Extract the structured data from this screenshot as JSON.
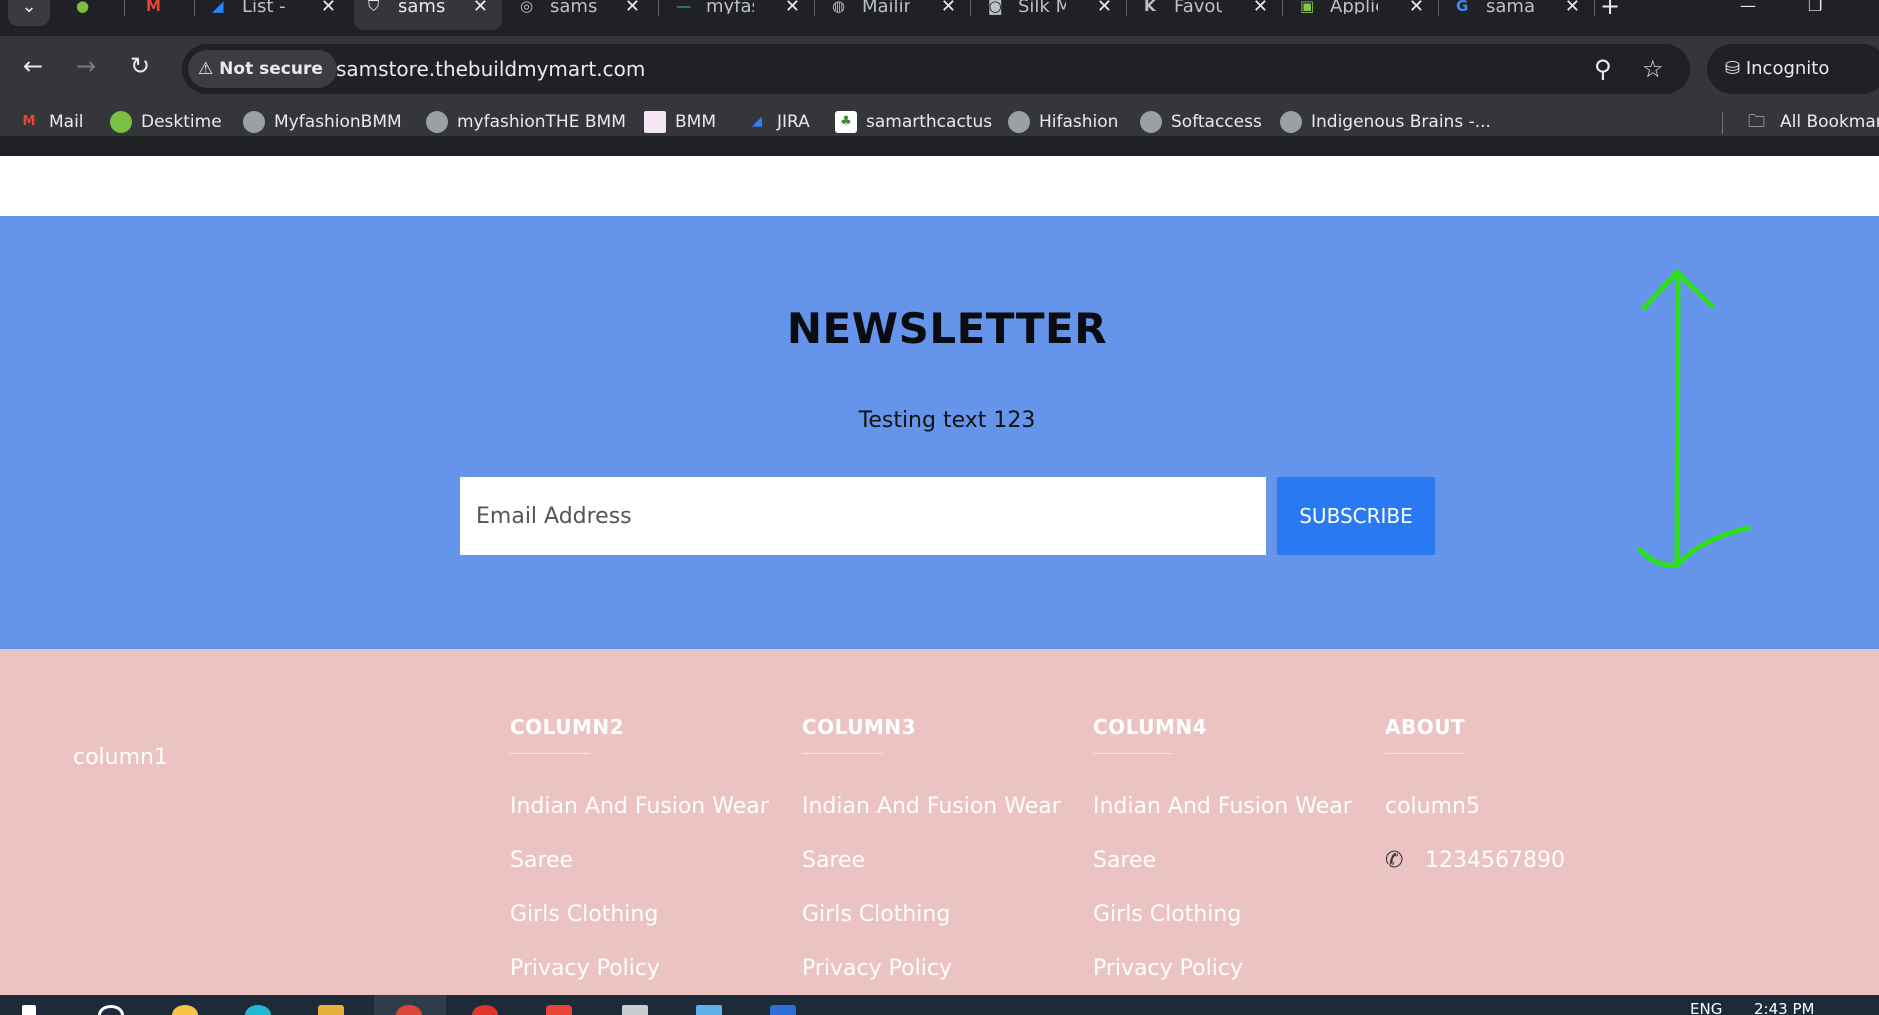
{
  "browser": {
    "tabs": [
      {
        "title": "",
        "favicon": "desktime-icon",
        "closable": false
      },
      {
        "title": "",
        "favicon": "gmail-icon",
        "closable": false
      },
      {
        "title": "List - I",
        "favicon": "jira-icon",
        "closable": true
      },
      {
        "title": "samstc",
        "favicon": "shield-icon",
        "closable": true,
        "active": true
      },
      {
        "title": "samstc",
        "favicon": "shopify-icon",
        "closable": true
      },
      {
        "title": "myfas",
        "favicon": "dash-icon",
        "closable": true
      },
      {
        "title": "Mailin",
        "favicon": "globe-icon",
        "closable": true
      },
      {
        "title": "Silk M",
        "favicon": "camera-icon",
        "closable": true
      },
      {
        "title": "Favou",
        "favicon": "k-icon",
        "closable": true
      },
      {
        "title": "Applic",
        "favicon": "image-icon",
        "closable": true
      },
      {
        "title": "samar",
        "favicon": "google-icon",
        "closable": true
      }
    ],
    "new_tab": "+",
    "security_label": "Not secure",
    "url": "samstore.thebuildmymart.com",
    "incognito_label": "Incognito",
    "bookmarks": [
      {
        "label": "Mail",
        "favicon": "gmail-icon"
      },
      {
        "label": "Desktime",
        "favicon": "desktime-icon"
      },
      {
        "label": "MyfashionBMM",
        "favicon": "globe-icon"
      },
      {
        "label": "myfashionTHE BMM",
        "favicon": "globe-icon"
      },
      {
        "label": "BMM",
        "favicon": "bmm-icon"
      },
      {
        "label": "JIRA",
        "favicon": "jira-icon"
      },
      {
        "label": "samarthcactus",
        "favicon": "cactus-icon"
      },
      {
        "label": "Hifashion",
        "favicon": "globe-icon"
      },
      {
        "label": "Softaccess",
        "favicon": "globe-icon"
      },
      {
        "label": "Indigenous Brains -...",
        "favicon": "globe-icon"
      }
    ],
    "all_bookmarks_label": "All Bookmarks"
  },
  "newsletter": {
    "title": "NEWSLETTER",
    "text": "Testing text 123",
    "email_placeholder": "Email Address",
    "subscribe_label": "SUBSCRIBE",
    "background": "#6595ea",
    "button_color": "#2979f2"
  },
  "footer": {
    "background": "#ebc3c3",
    "column1": "column1",
    "columns": [
      {
        "heading": "COLUMN2",
        "links": [
          "Indian And Fusion Wear",
          "Saree",
          "Girls Clothing",
          "Privacy Policy"
        ]
      },
      {
        "heading": "COLUMN3",
        "links": [
          "Indian And Fusion Wear",
          "Saree",
          "Girls Clothing",
          "Privacy Policy"
        ]
      },
      {
        "heading": "COLUMN4",
        "links": [
          "Indian And Fusion Wear",
          "Saree",
          "Girls Clothing",
          "Privacy Policy"
        ]
      }
    ],
    "about": {
      "heading": "ABOUT",
      "text": "column5",
      "phone": "1234567890"
    }
  },
  "taskbar": {
    "language": "ENG",
    "time": "2:43 PM"
  }
}
